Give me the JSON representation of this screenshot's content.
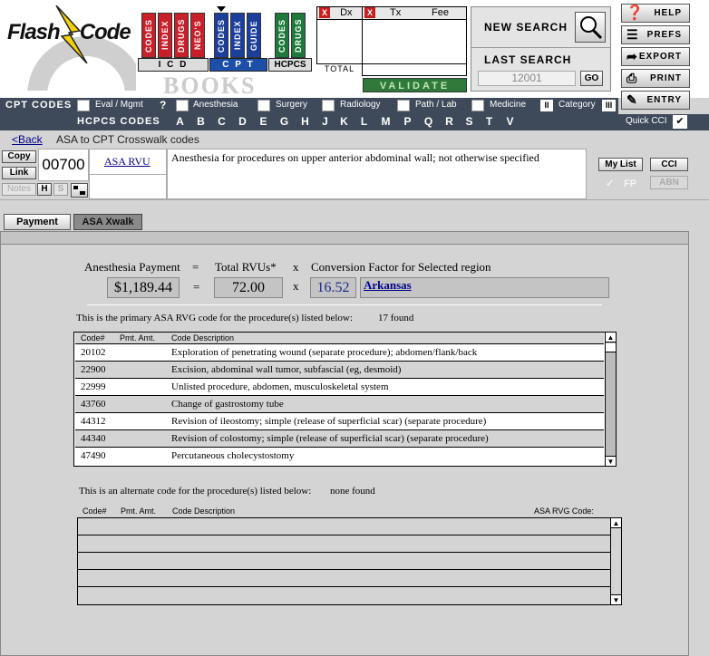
{
  "brand": {
    "logo_text": "FlashCode",
    "logo_left": "Flash",
    "logo_right": "Code",
    "watermark": "BOOKS"
  },
  "books": {
    "icd": [
      "CODES",
      "INDEX",
      "DRUGS",
      "NEO'S"
    ],
    "cpt": [
      "CODES",
      "INDEX",
      "GUIDE"
    ],
    "hcpcs": [
      "CODES",
      "DRUGS"
    ]
  },
  "book_tabs": {
    "icd": "I C D",
    "cpt": "C P T",
    "hcpcs": "HCPCS"
  },
  "claim": {
    "dx_label": "Dx",
    "tx_label": "Tx",
    "fee_label": "Fee",
    "total_label": "TOTAL",
    "validate_label": "VALIDATE",
    "x_icon": "X"
  },
  "search": {
    "new_search_label": "NEW SEARCH",
    "last_search_label": "LAST SEARCH",
    "last_search_value": "12001",
    "go_label": "GO"
  },
  "right_buttons": {
    "help": "HELP",
    "prefs": "PREFS",
    "export": "EXPORT",
    "print": "PRINT",
    "entry": "ENTRY"
  },
  "cpt_bar": {
    "title": "CPT CODES",
    "items": [
      "Eval / Mgmt",
      "Anesthesia",
      "Surgery",
      "Radiology",
      "Path / Lab",
      "Medicine",
      "Category"
    ],
    "help_glyph": "?",
    "roman_2": "II",
    "roman_3": "III"
  },
  "hcpcs_bar": {
    "title": "HCPCS CODES",
    "letters": [
      "A",
      "B",
      "C",
      "D",
      "E",
      "G",
      "H",
      "J",
      "K",
      "L",
      "M",
      "P",
      "Q",
      "R",
      "S",
      "T",
      "V"
    ],
    "quick_cci": "Quick CCI",
    "quick_cci_check": "✔"
  },
  "breadcrumb": {
    "back": "<Back",
    "title": "ASA to CPT Crosswalk codes"
  },
  "code_panel": {
    "copy": "Copy",
    "link": "Link",
    "notes": "Notes",
    "h": "H",
    "s": "S",
    "code": "00700",
    "rvu_link": "ASA RVU",
    "description": "Anesthesia for procedures on upper anterior abdominal wall; not otherwise specified",
    "my_list": "My List",
    "fp": "FP",
    "fp_check": "✓",
    "cci": "CCI",
    "abn": "ABN"
  },
  "tabs": {
    "payment": "Payment",
    "asa_xwalk": "ASA Xwalk"
  },
  "formula": {
    "payment_label": "Anesthesia Payment",
    "eq": "=",
    "rvu_label": "Total RVUs*",
    "x": "x",
    "cf_label": "Conversion Factor for Selected region",
    "payment_value": "$1,189.44",
    "rvu_value": "72.00",
    "cf_value": "16.52",
    "region": "Arkansas"
  },
  "primary": {
    "caption": "This is the primary ASA RVG code for the procedure(s) listed below:",
    "found": "17 found",
    "headers": [
      "Code#",
      "Pmt. Amt.",
      "Code Description"
    ],
    "rows": [
      {
        "code": "20102",
        "desc": "Exploration of penetrating wound (separate procedure); abdomen/flank/back"
      },
      {
        "code": "22900",
        "desc": "Excision, abdominal wall tumor, subfascial (eg, desmoid)"
      },
      {
        "code": "22999",
        "desc": "Unlisted procedure, abdomen, musculoskeletal system"
      },
      {
        "code": "43760",
        "desc": "Change of gastrostomy tube"
      },
      {
        "code": "44312",
        "desc": "Revision of ileostomy; simple (release of superficial scar) (separate procedure)"
      },
      {
        "code": "44340",
        "desc": "Revision of colostomy; simple (release of superficial scar) (separate procedure)"
      },
      {
        "code": "47490",
        "desc": "Percutaneous cholecystostomy"
      }
    ]
  },
  "alternate": {
    "caption": "This is an alternate code for the procedure(s) listed below:",
    "found": "none found",
    "headers": [
      "Code#",
      "Pmt. Amt.",
      "Code Description",
      "ASA RVG Code:"
    ]
  }
}
